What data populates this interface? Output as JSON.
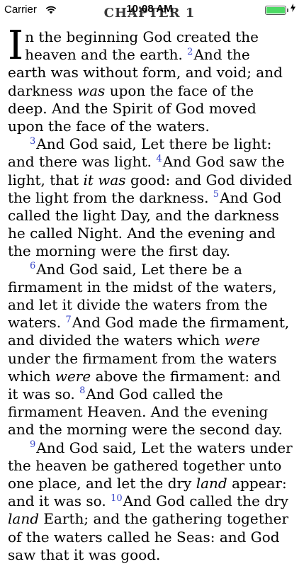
{
  "status_bar": {
    "carrier": "Carrier",
    "time": "10:08 AM",
    "battery_color": "#4cd964",
    "wifi_icon": "wifi-icon",
    "charging_icon": "charging-bolt-icon"
  },
  "chapter_title": "CHAPTER 1",
  "verse_number_color": "#3644c7",
  "verses": {
    "v1": {
      "dropcap": "I",
      "text": "n the beginning God created the heaven and the earth."
    },
    "v2": {
      "num": "2",
      "text_a": "And the earth was without form, and void; and darkness",
      "italic_1": "was",
      "text_b": "upon the face of the deep. And the Spirit of God moved upon the face of the waters."
    },
    "v3": {
      "num": "3",
      "text": "And God said, Let there be light: and there was light."
    },
    "v4": {
      "num": "4",
      "text_a": "And God saw the light, that",
      "italic_1": "it was",
      "text_b": "good: and God divided the light from the darkness."
    },
    "v5": {
      "num": "5",
      "text": "And God called the light Day, and the darkness he called Night. And the evening and the morning were the first day."
    },
    "v6": {
      "num": "6",
      "text": "And God said, Let there be a firmament in the midst of the waters, and let it divide the waters from the waters."
    },
    "v7": {
      "num": "7",
      "text_a": "And God made the firmament, and divided the waters which",
      "italic_1": "were",
      "text_b": "under the firmament from the waters which",
      "italic_2": "were",
      "text_c": "above the firmament: and it was so."
    },
    "v8": {
      "num": "8",
      "text": "And God called the firmament Heaven. And the evening and the morning were the second day."
    },
    "v9": {
      "num": "9",
      "text_a": "And God said, Let the waters under the heaven be gathered together unto one place, and let the dry",
      "italic_1": "land",
      "text_b": "appear: and it was so."
    },
    "v10": {
      "num": "10",
      "text_a": "And God called the dry",
      "italic_1": "land",
      "text_b": "Earth; and the gathering together of the waters called he Seas: and God saw that it was good."
    }
  }
}
